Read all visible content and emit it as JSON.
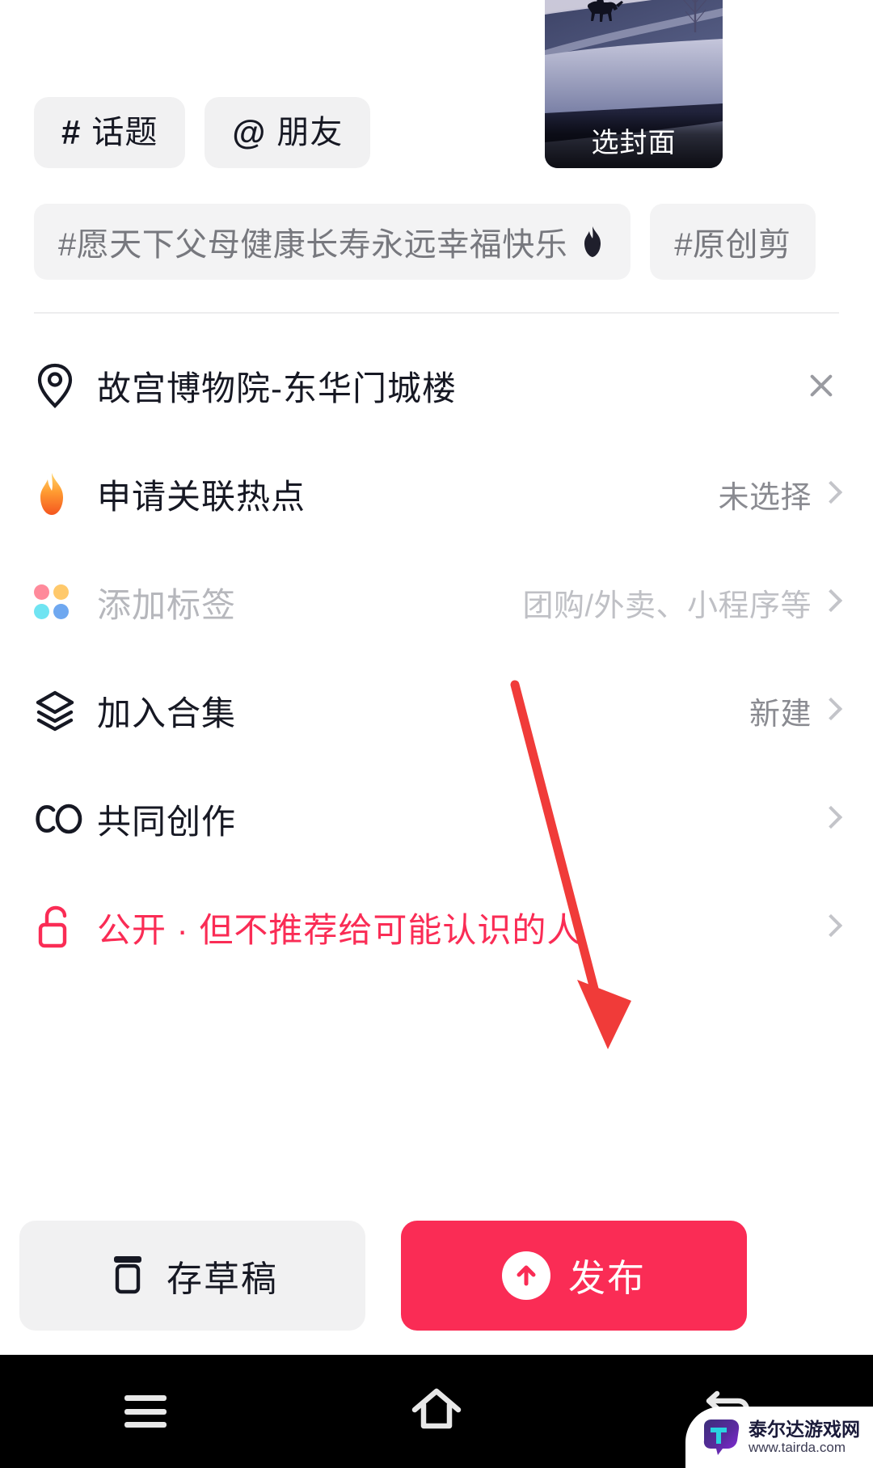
{
  "composer": {
    "actions": [
      {
        "symbol": "#",
        "label": "话题",
        "icon": "hash-icon"
      },
      {
        "symbol": "@",
        "label": "朋友",
        "icon": "at-icon"
      }
    ],
    "cover": {
      "label": "选封面",
      "icon": "cover-thumbnail"
    },
    "suggested_tags": [
      {
        "text": "#愿天下父母健康长寿永远幸福快乐",
        "trailing_icon": "flame-icon"
      },
      {
        "text": "#原创剪",
        "trailing_icon": ""
      }
    ]
  },
  "settings": {
    "rows": [
      {
        "icon": "location-pin-icon",
        "label": "故宫博物院-东华门城楼",
        "value": "",
        "trailing": "close-icon",
        "state": "active"
      },
      {
        "icon": "flame-icon",
        "label": "申请关联热点",
        "value": "未选择",
        "trailing": "chevron-right-icon",
        "state": "active"
      },
      {
        "icon": "four-dots-icon",
        "label": "添加标签",
        "value": "团购/外卖、小程序等",
        "trailing": "chevron-right-icon",
        "state": "disabled"
      },
      {
        "icon": "layers-icon",
        "label": "加入合集",
        "value": "新建",
        "trailing": "chevron-right-icon",
        "state": "active"
      },
      {
        "icon": "co-create-icon",
        "label": "共同创作",
        "value": "",
        "trailing": "chevron-right-icon",
        "state": "active"
      },
      {
        "icon": "unlock-icon",
        "label": "公开 · 但不推荐给可能认识的人",
        "value": "",
        "trailing": "chevron-right-icon",
        "state": "danger"
      }
    ]
  },
  "bottom_bar": {
    "draft": {
      "label": "存草稿",
      "icon": "draft-box-icon"
    },
    "publish": {
      "label": "发布",
      "icon": "arrow-up-circle-icon"
    }
  },
  "system_nav": {
    "items": [
      {
        "icon": "recents-menu-icon",
        "label": ""
      },
      {
        "icon": "home-icon",
        "label": ""
      },
      {
        "icon": "back-icon",
        "label": ""
      }
    ]
  },
  "watermark": {
    "title": "泰尔达游戏网",
    "url": "www.tairda.com",
    "icon": "tairda-logo-icon"
  },
  "colors": {
    "accent_red": "#fa2c55",
    "chip_bg": "#f1f1f2",
    "text_primary": "#161823",
    "text_secondary": "#8a8b91",
    "text_disabled": "#bfc0c5",
    "annotation_arrow": "#f03b39"
  }
}
